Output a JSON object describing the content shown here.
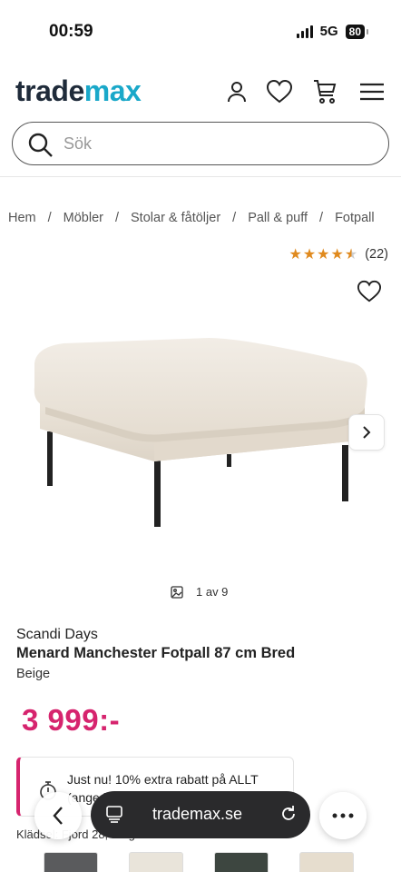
{
  "status_bar": {
    "time": "00:59",
    "network": "5G",
    "battery": "80"
  },
  "header": {
    "logo_part1": "trade",
    "logo_part2": "max",
    "icons": [
      "user-icon",
      "heart-icon",
      "cart-icon",
      "menu-icon"
    ]
  },
  "search": {
    "placeholder": "Sök",
    "value": ""
  },
  "breadcrumb": {
    "items": [
      "Hem",
      "Möbler",
      "Stolar & fåtöljer",
      "Pall & puff",
      "Fotpall"
    ],
    "separator": "/"
  },
  "rating": {
    "stars": 4.5,
    "count": "(22)"
  },
  "gallery": {
    "counter": "1 av 9"
  },
  "product": {
    "brand": "Scandi Days",
    "title": "Menard Manchester Fotpall 87 cm Bred",
    "color": "Beige",
    "price": "3 999:-"
  },
  "promo": {
    "text": "Just nu! 10% extra rabatt på ALLT (ange kod: 10ALLT)"
  },
  "variants": {
    "label": "Klädsel: Fjord 28, Beige Manchester",
    "swatch_colors": [
      "#5a5b5d",
      "#e9e4da",
      "#3d4640",
      "#e6ddce"
    ]
  },
  "browser": {
    "url": "trademax.se"
  },
  "colors": {
    "brand_dark": "#1f2b3a",
    "brand_accent": "#1aa8c9",
    "price": "#d6246e",
    "star": "#e08a1e"
  }
}
